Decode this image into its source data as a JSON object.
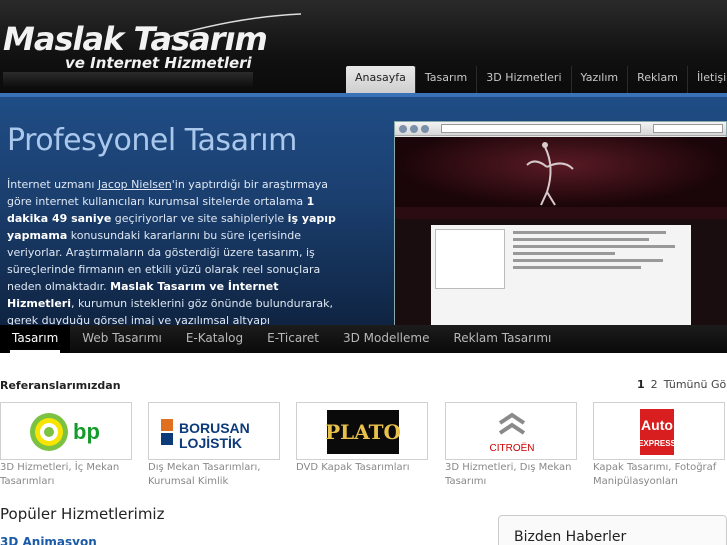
{
  "brand": {
    "title": "Maslak Tasarım",
    "subtitle": "ve Internet Hizmetleri"
  },
  "topnav": [
    "Anasayfa",
    "Tasarım",
    "3D Hizmetleri",
    "Yazılım",
    "Reklam",
    "İletişim"
  ],
  "hero": {
    "title": "Profesyonel Tasarım",
    "p1": "İnternet uzmanı ",
    "link": "Jacop Nielsen",
    "p2": "'in yaptırdığı bir araştırmaya göre internet kullanıcıları kurumsal sitelerde ortalama ",
    "b1": "1 dakika 49 saniye",
    "p3": " geçiriyorlar ve site sahipleriyle ",
    "b2": "iş yapıp yapmama",
    "p4": " konusundaki kararlarını bu süre içerisinde veriyorlar. Araştırmaların da gösterdiği üzere tasarım, iş süreçlerinde firmanın en etkili yüzü olarak reel sonuçlara neden olmaktadır. ",
    "b3": "Maslak Tasarım ve İnternet Hizmetleri",
    "p5": ", kurumun isteklerini göz önünde bulundurarak, gerek duyduğu görsel imaj ve yazılımsal altyapı gereksinimlerini profesyonel ve optimum sonuç alınacak şekilde"
  },
  "tabs": [
    "Tasarım",
    "Web Tasarımı",
    "E-Katalog",
    "E-Ticaret",
    "3D Modelleme",
    "Reklam Tasarımı"
  ],
  "references": {
    "title": "Referanslarımızdan",
    "pages": [
      "1",
      "2"
    ],
    "all_label": "Tümünü Gör",
    "items": [
      {
        "logo": "bp",
        "caption": "3D Hizmetleri, İç Mekan Tasarımları"
      },
      {
        "logo": "BORUSAN LOJİSTİK",
        "caption": "Dış Mekan Tasarımları, Kurumsal Kimlik"
      },
      {
        "logo": "PLATO",
        "caption": "DVD Kapak Tasarımları"
      },
      {
        "logo": "CITROËN",
        "caption": "3D Hizmetleri, Dış Mekan Tasarımı"
      },
      {
        "logo": "Auto EXPRESS",
        "caption": "Kapak Tasarımı, Fotoğraf Manipülasyonları"
      }
    ]
  },
  "popular": {
    "title": "Popüler Hizmetlerimiz",
    "first_item": "3D Animasyon"
  },
  "news": {
    "title": "Bizden Haberler"
  },
  "colors": {
    "accent": "#1b5aa8",
    "hero_bg": "#1b3f6f",
    "header_bg": "#111111"
  }
}
